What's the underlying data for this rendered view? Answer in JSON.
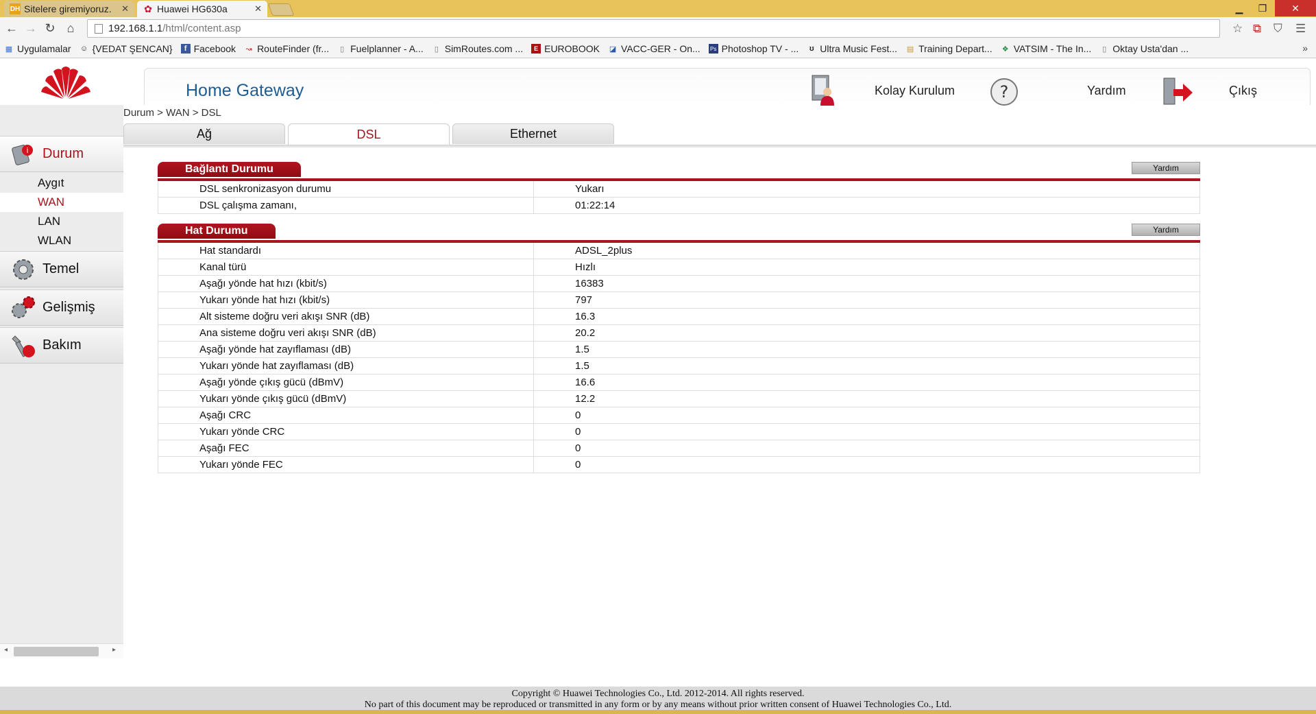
{
  "browser": {
    "tabs": [
      {
        "title": "Sitelere giremiyoruz.",
        "favicon": "DH"
      },
      {
        "title": "Huawei HG630a",
        "favicon": "huawei-icon"
      }
    ],
    "url_host": "192.168.1.1",
    "url_path": "/html/content.asp",
    "bookmarks": [
      "Uygulamalar",
      "{VEDAT ŞENCAN}",
      "Facebook",
      "RouteFinder (fr...",
      "Fuelplanner - A...",
      "SimRoutes.com ...",
      "EUROBOOK",
      "VACC-GER - On...",
      "Photoshop TV - ...",
      "Ultra Music Fest...",
      "Training Depart...",
      "VATSIM - The In...",
      "Oktay Usta'dan ..."
    ],
    "more": "»"
  },
  "header": {
    "title": "Home Gateway",
    "quick_setup": "Kolay Kurulum",
    "help": "Yardım",
    "logout": "Çıkış"
  },
  "breadcrumb": "Durum > WAN > DSL",
  "sidebar": {
    "status": "Durum",
    "sub": [
      "Aygıt",
      "WAN",
      "LAN",
      "WLAN"
    ],
    "basic": "Temel",
    "advanced": "Gelişmiş",
    "maintenance": "Bakım"
  },
  "tabs": [
    "Ağ",
    "DSL",
    "Ethernet"
  ],
  "connection": {
    "title": "Bağlantı Durumu",
    "help": "Yardım",
    "rows": [
      {
        "label": "DSL senkronizasyon durumu",
        "value": "Yukarı"
      },
      {
        "label": "DSL çalışma zamanı,",
        "value": "01:22:14"
      }
    ]
  },
  "line": {
    "title": "Hat Durumu",
    "help": "Yardım",
    "rows": [
      {
        "label": "Hat standardı",
        "value": "ADSL_2plus"
      },
      {
        "label": "Kanal türü",
        "value": "Hızlı"
      },
      {
        "label": "Aşağı yönde hat hızı (kbit/s)",
        "value": "16383"
      },
      {
        "label": "Yukarı yönde hat hızı (kbit/s)",
        "value": "797"
      },
      {
        "label": "Alt sisteme doğru veri akışı SNR (dB)",
        "value": "16.3"
      },
      {
        "label": "Ana sisteme doğru veri akışı SNR (dB)",
        "value": "20.2"
      },
      {
        "label": "Aşağı yönde hat zayıflaması (dB)",
        "value": "1.5"
      },
      {
        "label": "Yukarı yönde hat zayıflaması (dB)",
        "value": "1.5"
      },
      {
        "label": "Aşağı yönde çıkış gücü (dBmV)",
        "value": "16.6"
      },
      {
        "label": "Yukarı yönde çıkış gücü (dBmV)",
        "value": "12.2"
      },
      {
        "label": "Aşağı CRC",
        "value": "0"
      },
      {
        "label": "Yukarı yönde CRC",
        "value": "0"
      },
      {
        "label": "Aşağı FEC",
        "value": "0"
      },
      {
        "label": "Yukarı yönde FEC",
        "value": "0"
      }
    ]
  },
  "footer": {
    "copyright": "Copyright © Huawei Technologies Co., Ltd. 2012-2014. All rights reserved.",
    "notice": "No part of this document may be reproduced or transmitted in any form or by any means without prior written consent of Huawei Technologies Co., Ltd."
  },
  "colors": {
    "accent": "#a8131c",
    "title_blue": "#1f5d91"
  }
}
